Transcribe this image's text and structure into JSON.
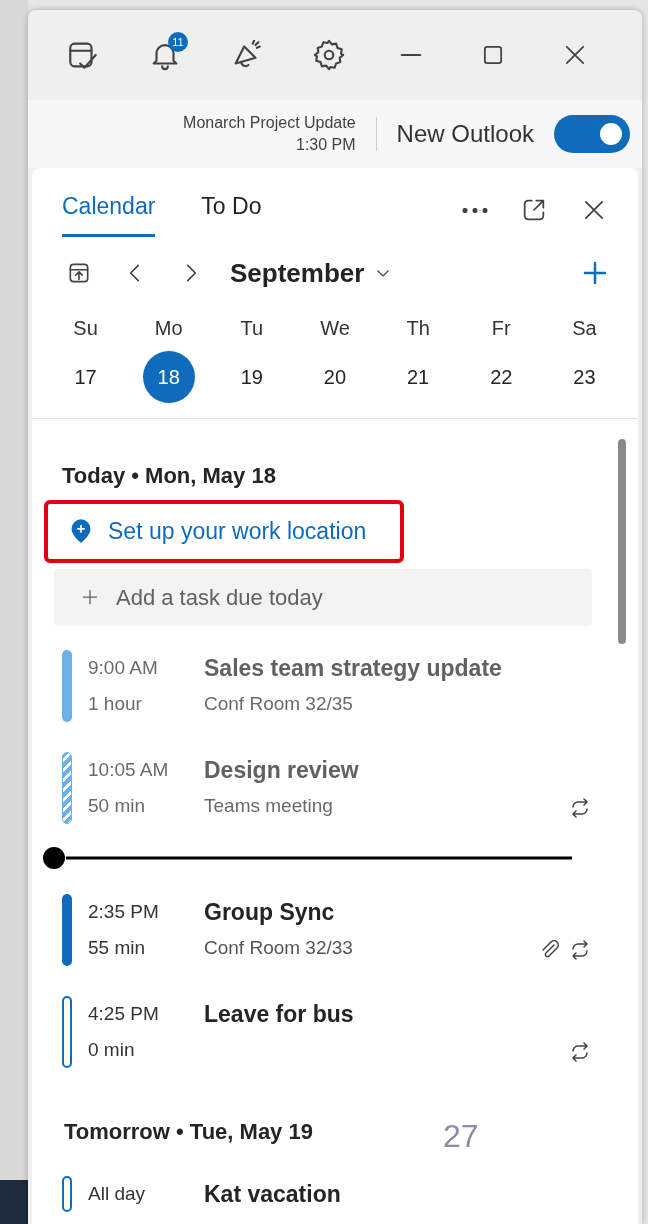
{
  "title_bar": {
    "notification_count": "11"
  },
  "banner": {
    "next_meeting": "Monarch Project Update",
    "next_meeting_time": "1:30 PM",
    "new_outlook_label": "New Outlook",
    "new_outlook_on": true
  },
  "tabs": [
    {
      "label": "Calendar",
      "selected": true
    },
    {
      "label": "To Do",
      "selected": false
    }
  ],
  "month_picker": {
    "month": "September"
  },
  "week": [
    {
      "day": "Su",
      "date": "17",
      "selected": false
    },
    {
      "day": "Mo",
      "date": "18",
      "selected": true
    },
    {
      "day": "Tu",
      "date": "19",
      "selected": false
    },
    {
      "day": "We",
      "date": "20",
      "selected": false
    },
    {
      "day": "Th",
      "date": "21",
      "selected": false
    },
    {
      "day": "Fr",
      "date": "22",
      "selected": false
    },
    {
      "day": "Sa",
      "date": "23",
      "selected": false
    }
  ],
  "agenda": [
    {
      "heading": "Today • Mon, May 18",
      "work_location": {
        "label": "Set up your work location",
        "highlighted": true
      },
      "add_task_placeholder": "Add a task due today",
      "items": [
        {
          "kind": "busy",
          "past": true,
          "time": "9:00 AM",
          "duration": "1 hour",
          "title": "Sales team strategy update",
          "location": "Conf Room 32/35",
          "attachment": false,
          "recurring": false
        },
        {
          "kind": "tentative",
          "past": true,
          "time": "10:05 AM",
          "duration": "50 min",
          "title": "Design review",
          "location": "Teams meeting",
          "attachment": false,
          "recurring": true
        },
        {
          "kind": "now"
        },
        {
          "kind": "busy",
          "past": false,
          "time": "2:35 PM",
          "duration": "55 min",
          "title": "Group Sync",
          "location": "Conf Room 32/33",
          "attachment": true,
          "recurring": true
        },
        {
          "kind": "free",
          "past": false,
          "time": "4:25 PM",
          "duration": "0 min",
          "title": "Leave for bus",
          "attachment": false,
          "recurring": true
        }
      ]
    },
    {
      "heading": "Tomorrow • Tue, May 19",
      "items": [
        {
          "kind": "free",
          "past": false,
          "time": "All day",
          "title": "Kat vacation",
          "attachment": false,
          "recurring": false
        }
      ]
    }
  ],
  "overlay_number": "27"
}
